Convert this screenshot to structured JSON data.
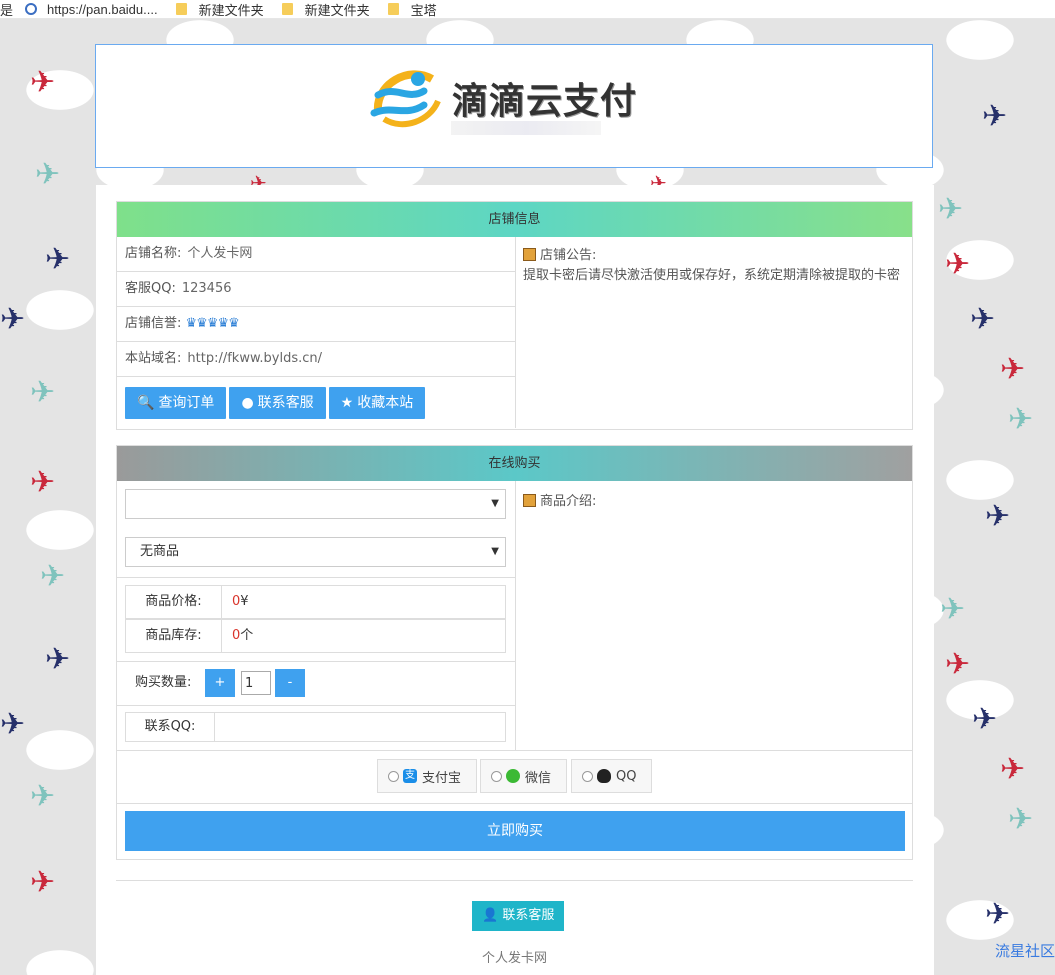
{
  "bookmarks": {
    "first": "是",
    "link": "https://pan.baidu....",
    "folders": [
      "新建文件夹",
      "新建文件夹",
      "宝塔"
    ]
  },
  "header": {
    "logo_title": "滴滴云支付"
  },
  "shop": {
    "section_title": "店铺信息",
    "name_label": "店铺名称:",
    "name_value": "个人发卡网",
    "qq_label": "客服QQ:",
    "qq_value": "123456",
    "credit_label": "店铺信誉:",
    "credit_icons": "🜲🜲🜲🜲🜲",
    "domain_label": "本站域名:",
    "domain_value": "http://fkww.bylds.cn/",
    "buttons": {
      "query": "查询订单",
      "service": "联系客服",
      "favorite": "收藏本站"
    },
    "notice_title": "店铺公告:",
    "notice_text": "提取卡密后请尽快激活使用或保存好，系统定期清除被提取的卡密"
  },
  "buy": {
    "section_title": "在线购买",
    "category_select": "",
    "product_select": "无商品",
    "price_label": "商品价格:",
    "price_value": "0",
    "price_unit": "¥",
    "stock_label": "商品库存:",
    "stock_value": "0",
    "stock_unit": "个",
    "qty_label": "购买数量:",
    "qty_plus": "+",
    "qty_value": "1",
    "qty_minus": "-",
    "contact_label": "联系QQ:",
    "contact_value": "",
    "intro_label": "商品介绍:",
    "pay_options": [
      "支付宝",
      "微信",
      "QQ"
    ],
    "buy_button": "立即购买"
  },
  "footer": {
    "contact_button": "联系客服",
    "site_name": "个人发卡网"
  },
  "watermark": "流星社区",
  "colors": {
    "primary": "#3fa1ef",
    "price_red": "#d9342b",
    "contact_teal": "#1fb5c9"
  }
}
